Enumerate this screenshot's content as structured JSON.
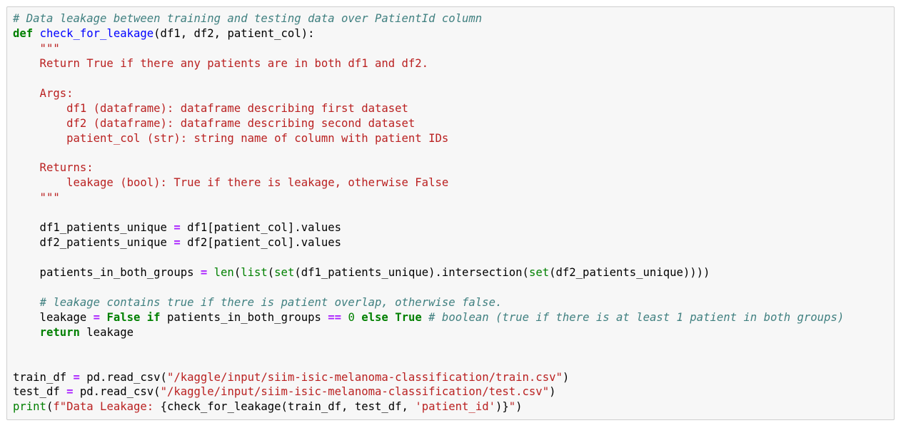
{
  "cell": {
    "lines": [
      [
        [
          "com",
          "# Data leakage between training and testing data over PatientId column"
        ]
      ],
      [
        [
          "kw",
          "def"
        ],
        [
          "txt",
          " "
        ],
        [
          "fn",
          "check_for_leakage"
        ],
        [
          "txt",
          "(df1, df2, patient_col):"
        ]
      ],
      [
        [
          "doc",
          "    \"\"\""
        ]
      ],
      [
        [
          "doc",
          "    Return True if there any patients are in both df1 and df2."
        ]
      ],
      [
        [
          "doc",
          ""
        ]
      ],
      [
        [
          "doc",
          "    Args:"
        ]
      ],
      [
        [
          "doc",
          "        df1 (dataframe): dataframe describing first dataset"
        ]
      ],
      [
        [
          "doc",
          "        df2 (dataframe): dataframe describing second dataset"
        ]
      ],
      [
        [
          "doc",
          "        patient_col (str): string name of column with patient IDs"
        ]
      ],
      [
        [
          "doc",
          ""
        ]
      ],
      [
        [
          "doc",
          "    Returns:"
        ]
      ],
      [
        [
          "doc",
          "        leakage (bool): True if there is leakage, otherwise False"
        ]
      ],
      [
        [
          "doc",
          "    \"\"\""
        ]
      ],
      [
        [
          "txt",
          ""
        ]
      ],
      [
        [
          "txt",
          "    df1_patients_unique "
        ],
        [
          "op",
          "="
        ],
        [
          "txt",
          " df1[patient_col].values"
        ]
      ],
      [
        [
          "txt",
          "    df2_patients_unique "
        ],
        [
          "op",
          "="
        ],
        [
          "txt",
          " df2[patient_col].values"
        ]
      ],
      [
        [
          "txt",
          ""
        ]
      ],
      [
        [
          "txt",
          "    patients_in_both_groups "
        ],
        [
          "op",
          "="
        ],
        [
          "txt",
          " "
        ],
        [
          "bi",
          "len"
        ],
        [
          "txt",
          "("
        ],
        [
          "bi",
          "list"
        ],
        [
          "txt",
          "("
        ],
        [
          "bi",
          "set"
        ],
        [
          "txt",
          "(df1_patients_unique).intersection("
        ],
        [
          "bi",
          "set"
        ],
        [
          "txt",
          "(df2_patients_unique))))"
        ]
      ],
      [
        [
          "txt",
          ""
        ]
      ],
      [
        [
          "txt",
          "    "
        ],
        [
          "com",
          "# leakage contains true if there is patient overlap, otherwise false."
        ]
      ],
      [
        [
          "txt",
          "    leakage "
        ],
        [
          "op",
          "="
        ],
        [
          "txt",
          " "
        ],
        [
          "kw",
          "False"
        ],
        [
          "txt",
          " "
        ],
        [
          "kw",
          "if"
        ],
        [
          "txt",
          " patients_in_both_groups "
        ],
        [
          "op",
          "=="
        ],
        [
          "txt",
          " "
        ],
        [
          "num",
          "0"
        ],
        [
          "txt",
          " "
        ],
        [
          "kw",
          "else"
        ],
        [
          "txt",
          " "
        ],
        [
          "kw",
          "True"
        ],
        [
          "txt",
          " "
        ],
        [
          "com",
          "# boolean (true if there is at least 1 patient in both groups)"
        ]
      ],
      [
        [
          "txt",
          "    "
        ],
        [
          "kw",
          "return"
        ],
        [
          "txt",
          " leakage"
        ]
      ],
      [
        [
          "txt",
          ""
        ]
      ],
      [
        [
          "txt",
          ""
        ]
      ],
      [
        [
          "txt",
          "train_df "
        ],
        [
          "op",
          "="
        ],
        [
          "txt",
          " pd.read_csv("
        ],
        [
          "str",
          "\"/kaggle/input/siim-isic-melanoma-classification/train.csv\""
        ],
        [
          "txt",
          ")"
        ]
      ],
      [
        [
          "txt",
          "test_df "
        ],
        [
          "op",
          "="
        ],
        [
          "txt",
          " pd.read_csv("
        ],
        [
          "str",
          "\"/kaggle/input/siim-isic-melanoma-classification/test.csv\""
        ],
        [
          "txt",
          ")"
        ]
      ],
      [
        [
          "bi",
          "print"
        ],
        [
          "txt",
          "("
        ],
        [
          "str",
          "f\"Data Leakage: "
        ],
        [
          "txt",
          "{check_for_leakage(train_df, test_df, "
        ],
        [
          "str",
          "'patient_id'"
        ],
        [
          "txt",
          ")}"
        ],
        [
          "str",
          "\""
        ],
        [
          "txt",
          ")"
        ]
      ]
    ]
  }
}
